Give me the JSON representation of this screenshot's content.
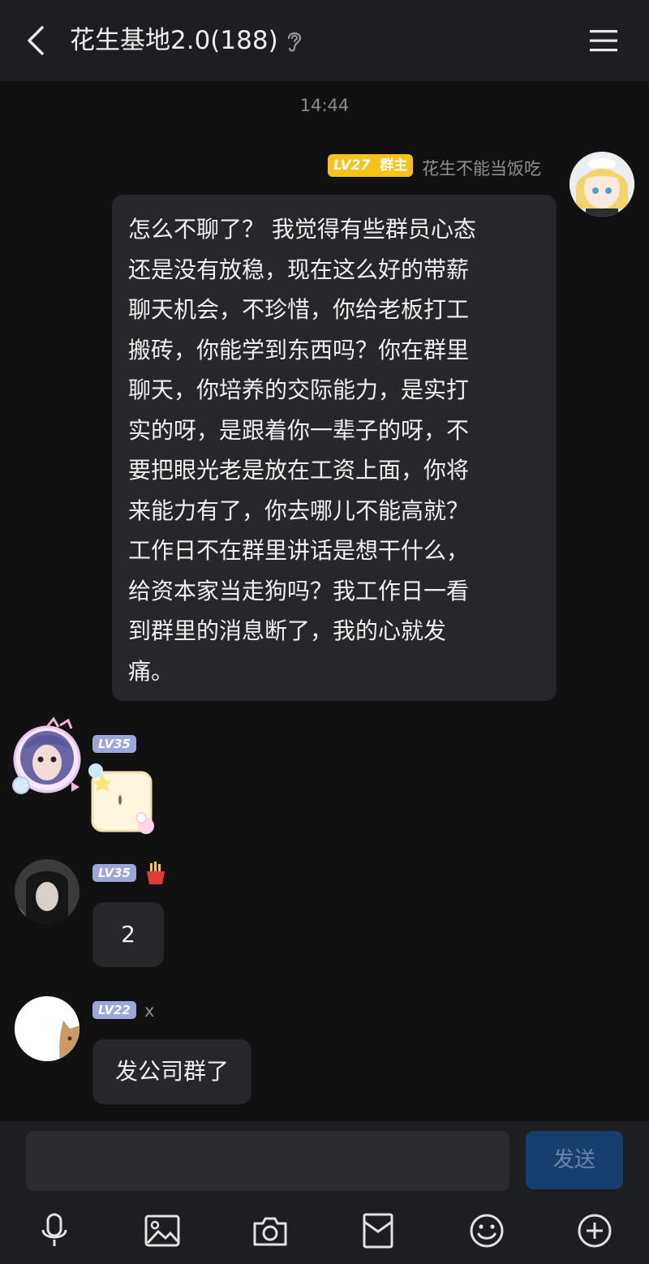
{
  "header": {
    "title": "花生基地2.0(188)"
  },
  "chat": {
    "time": "14:44",
    "messages": [
      {
        "level": "LV27",
        "role": "群主",
        "nickname": "花生不能当饭吃",
        "text_lines": [
          "怎么不聊了？ 我觉得有些群员心态",
          "还是没有放稳，现在这么好的带薪",
          "聊天机会，不珍惜，你给老板打工",
          "搬砖，你能学到东西吗？你在群里",
          "聊天，你培养的交际能力，是实打",
          "实的呀，是跟着你一辈子的呀，不",
          "要把眼光老是放在工资上面，你将",
          "来能力有了，你去哪儿不能高就？",
          "工作日不在群里讲话是想干什么，",
          "给资本家当走狗吗？我工作日一看",
          "到群里的消息断了，我的心就发",
          "痛。"
        ]
      },
      {
        "level": "LV35",
        "sticker": "kitty-sticker"
      },
      {
        "level": "LV35",
        "nick_icon": "fries-icon",
        "text": "2"
      },
      {
        "level": "LV22",
        "nickname": "x",
        "text": "发公司群了"
      }
    ]
  },
  "input": {
    "value": "",
    "send_label": "发送"
  },
  "toolbar": [
    "microphone-icon",
    "image-icon",
    "camera-icon",
    "redpacket-icon",
    "emoji-icon",
    "plus-icon"
  ]
}
